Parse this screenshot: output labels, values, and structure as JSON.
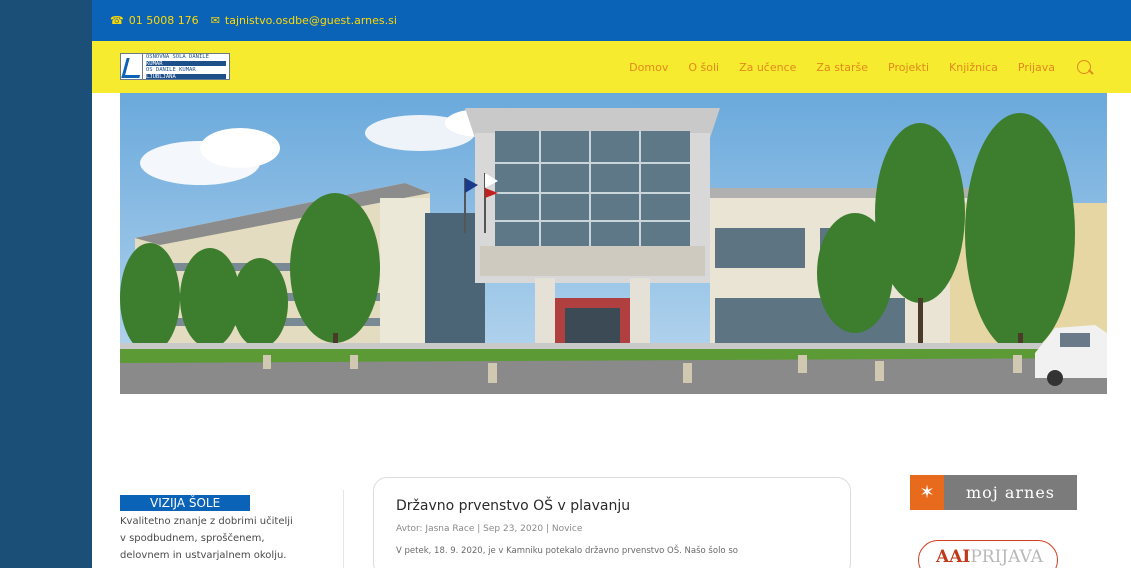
{
  "topbar": {
    "phone": "01 5008 176",
    "email": "tajnistvo.osdbe@guest.arnes.si",
    "phone_icon": "phone-icon",
    "email_icon": "envelope-icon"
  },
  "logo": {
    "lines": [
      "OSNOVNA ŠOLA DANILE",
      "KUMAR",
      "OŠ DANILE KUMAR",
      "LJUBLJANA"
    ]
  },
  "nav": {
    "items": [
      "Domov",
      "O šoli",
      "Za učence",
      "Za starše",
      "Projekti",
      "Knjižnica",
      "Prijava"
    ],
    "search_icon": "search-icon"
  },
  "hero": {
    "alt": "school-building-photo"
  },
  "vision": {
    "title": "VIZIJA ŠOLE",
    "lines": [
      "Kvalitetno znanje z dobrimi učitelji",
      "v spodbudnem, sproščenem,",
      "delovnem in ustvarjalnem okolju."
    ]
  },
  "post": {
    "title": "Državno prvenstvo OŠ v plavanju",
    "meta": "Avtor: Jasna Race | Sep 23, 2020 | Novice",
    "excerpt": "V petek, 18. 9. 2020, je v Kamniku potekalo državno prvenstvo OŠ. Našo šolo so"
  },
  "sidebar": {
    "arnes_label": "moj arnes",
    "aai_label_a": "AAI",
    "aai_label_b": "PRIJAVA"
  },
  "colors": {
    "topbar": "#0b63b8",
    "header": "#f6eb2e",
    "nav_text": "#e08a1e",
    "left_strip": "#1c4f78"
  }
}
